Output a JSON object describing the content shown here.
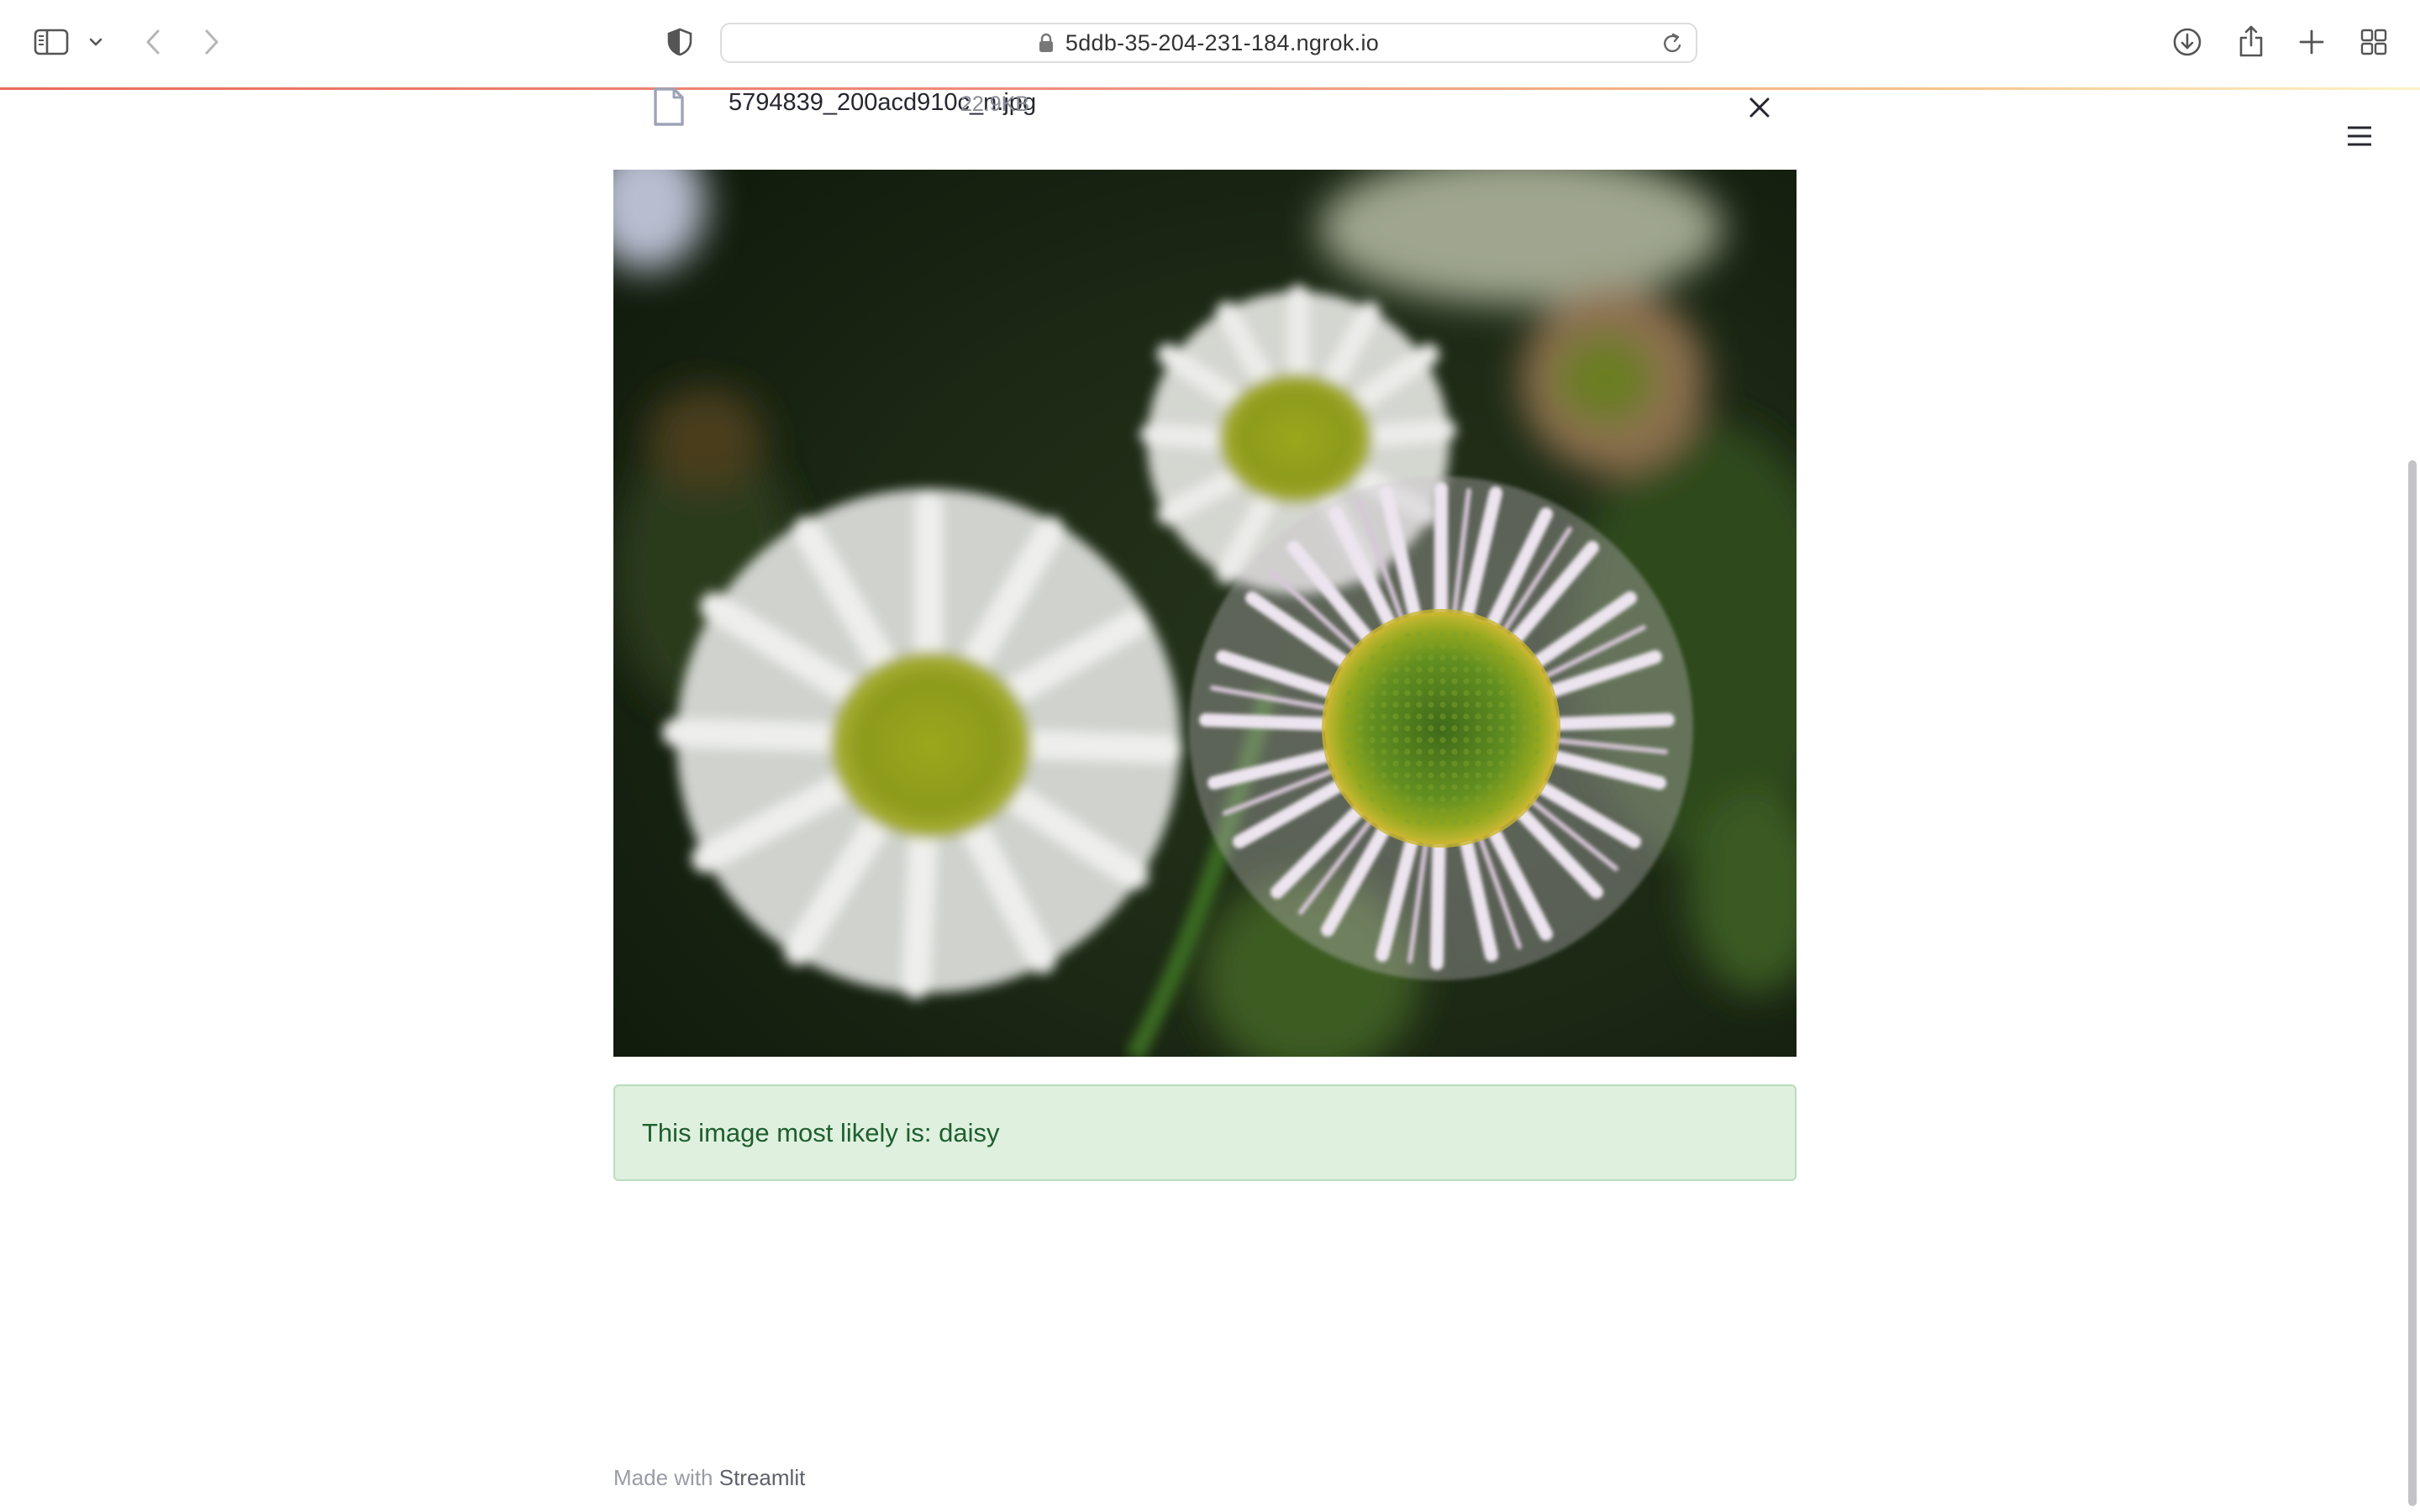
{
  "browser": {
    "url": "5ddb-35-204-231-184.ngrok.io"
  },
  "uploaded_file": {
    "name": "5794839_200acd910c_n.jpg",
    "size": "22.9KB"
  },
  "prediction": {
    "text": "This image most likely is: daisy",
    "color": "#dff0df"
  },
  "footer": {
    "prefix": "Made with",
    "brand": "Streamlit"
  },
  "icons": {
    "sidebar": "sidebar-icon",
    "back": "chevron-left-icon",
    "forward": "chevron-right-icon",
    "privacy": "shield-icon",
    "lock": "lock-icon",
    "reload": "reload-icon",
    "download": "download-icon",
    "share": "share-icon",
    "new_tab": "plus-icon",
    "tab_overview": "grid-icon",
    "file": "file-icon",
    "close": "close-icon",
    "menu": "hamburger-menu-icon"
  }
}
